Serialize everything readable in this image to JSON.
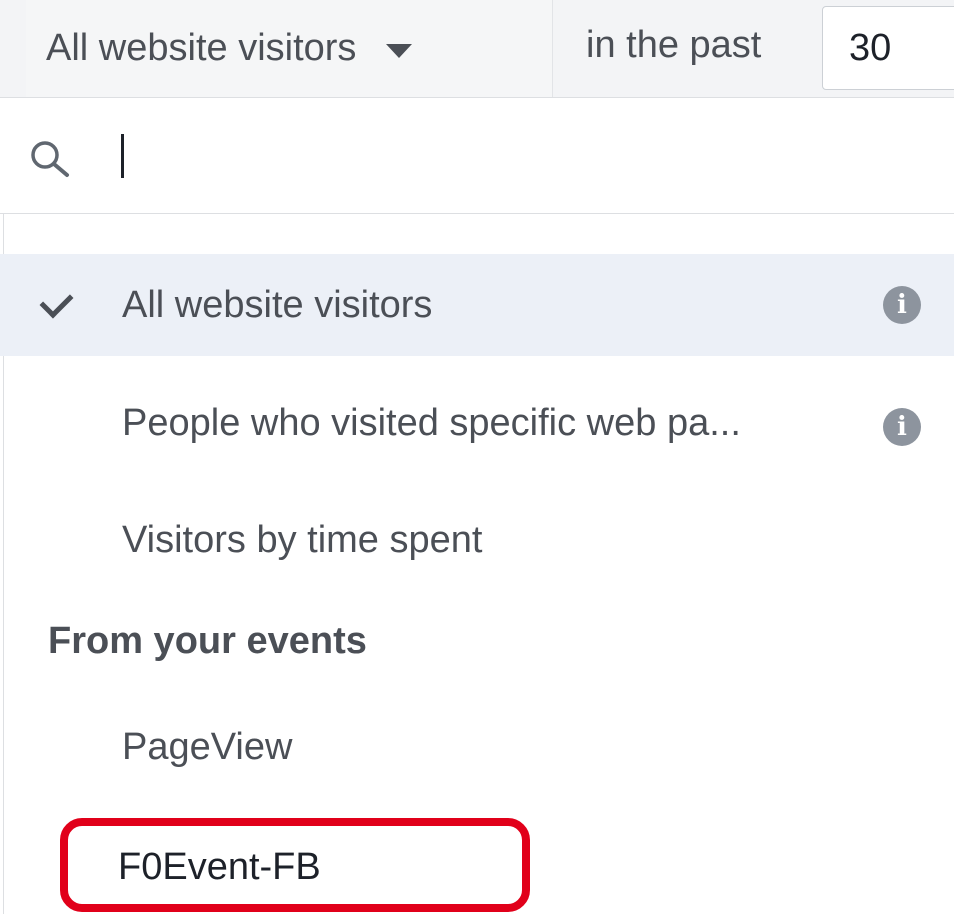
{
  "header": {
    "audience_selected": "All website visitors",
    "in_the_past_label": "in the past",
    "days_value": "30"
  },
  "search": {
    "placeholder": ""
  },
  "menu": {
    "items": [
      {
        "label": "All website visitors",
        "selected": true,
        "has_info": true,
        "info_icon": "info-circle-icon"
      },
      {
        "label": "People who visited specific web pa...",
        "selected": false,
        "has_info": true,
        "info_icon": "info-circle-icon"
      },
      {
        "label": "Visitors by time spent",
        "selected": false,
        "has_info": false
      }
    ],
    "section_header": "From your events",
    "events": [
      {
        "label": "PageView"
      },
      {
        "label": "F0Event-FB",
        "highlighted": true
      }
    ]
  },
  "colors": {
    "selected_bg": "#ecf0f7",
    "highlight_border": "#e1001a",
    "text": "#4b4f56",
    "info_icon": "#8d949e"
  }
}
